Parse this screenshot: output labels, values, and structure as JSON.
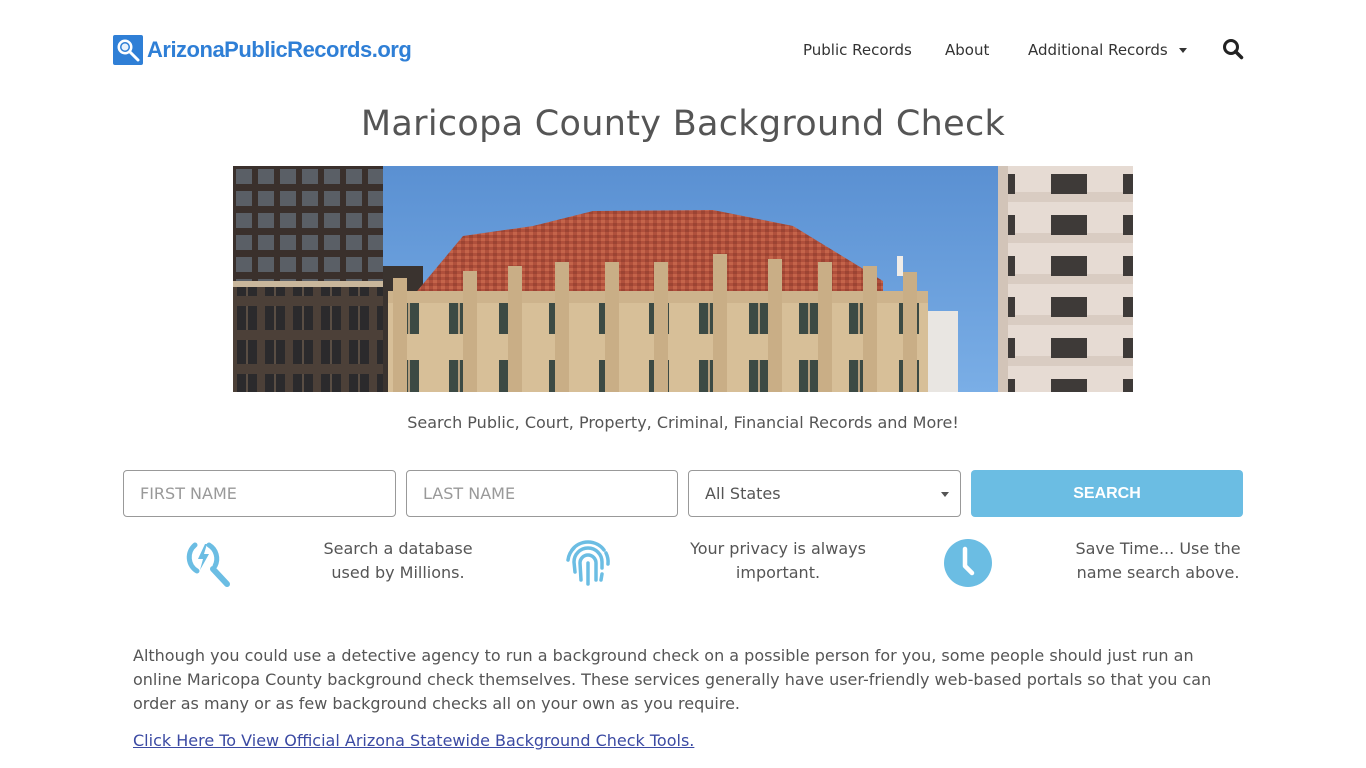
{
  "site": {
    "logo_text": "ArizonaPublicRecords.org",
    "brand_color": "#2f7fd6"
  },
  "nav": {
    "items": [
      {
        "label": "Public Records"
      },
      {
        "label": "About"
      },
      {
        "label": "Additional Records",
        "has_dropdown": true
      }
    ],
    "search_icon": "search-icon"
  },
  "page": {
    "title": "Maricopa County Background Check",
    "hero_image_alt": "Maricopa County building with red tile roof between high-rise towers",
    "tagline": "Search Public, Court, Property, Criminal, Financial Records and More!"
  },
  "search_form": {
    "first_name_placeholder": "FIRST NAME",
    "last_name_placeholder": "LAST NAME",
    "state_selected": "All States",
    "submit_label": "SEARCH",
    "accent_color": "#6bbde3"
  },
  "features": [
    {
      "icon": "search-lightning-icon",
      "line1": "Search a database",
      "line2": "used by Millions."
    },
    {
      "icon": "fingerprint-icon",
      "line1": "Your privacy is always",
      "line2": "important."
    },
    {
      "icon": "clock-icon",
      "line1": "Save Time... Use the",
      "line2": "name search above."
    }
  ],
  "content": {
    "paragraph": "Although you could use a detective agency to run a background check on a possible person for you, some people should just run an online Maricopa County background check themselves. These services generally have user-friendly web-based portals so that you can order as many or as few background checks all on your own as you require.",
    "link_text": "Click Here To View Official Arizona Statewide Background Check Tools."
  }
}
